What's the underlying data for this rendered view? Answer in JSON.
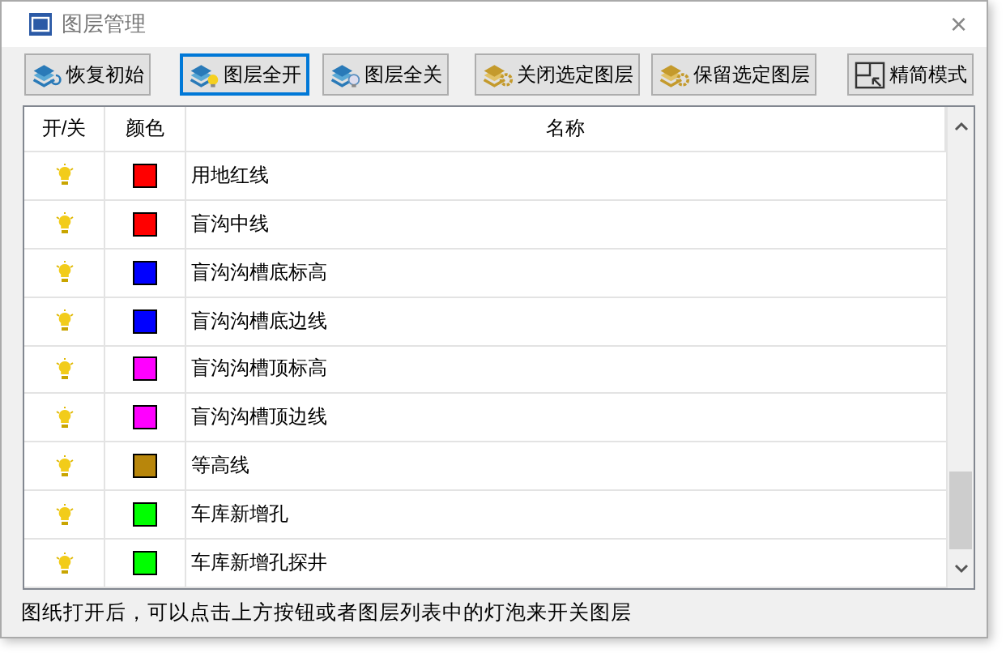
{
  "window": {
    "title": "图层管理",
    "close": "×"
  },
  "toolbar": [
    {
      "label": "恢复初始",
      "kind": "restore",
      "selected": false
    },
    {
      "label": "图层全开",
      "kind": "open",
      "selected": true
    },
    {
      "label": "图层全关",
      "kind": "shut",
      "selected": false
    },
    {
      "label": "关闭选定图层",
      "kind": "gold",
      "selected": false
    },
    {
      "label": "保留选定图层",
      "kind": "gold",
      "selected": false
    },
    {
      "label": "精简模式",
      "kind": "mode",
      "selected": false
    }
  ],
  "table": {
    "columns": [
      "开/关",
      "颜色",
      "名称"
    ],
    "rows": [
      {
        "on": true,
        "color": "#ff0000",
        "name": "用地红线"
      },
      {
        "on": true,
        "color": "#ff0000",
        "name": "盲沟中线"
      },
      {
        "on": true,
        "color": "#0000ff",
        "name": "盲沟沟槽底标高"
      },
      {
        "on": true,
        "color": "#0000ff",
        "name": "盲沟沟槽底边线"
      },
      {
        "on": true,
        "color": "#ff00ff",
        "name": "盲沟沟槽顶标高"
      },
      {
        "on": true,
        "color": "#ff00ff",
        "name": "盲沟沟槽顶边线"
      },
      {
        "on": true,
        "color": "#b8860b",
        "name": "等高线"
      },
      {
        "on": true,
        "color": "#00ff00",
        "name": "车库新增孔"
      },
      {
        "on": true,
        "color": "#00ff00",
        "name": "车库新增孔探井"
      }
    ]
  },
  "status_bar": "图纸打开后，可以点击上方按钮或者图层列表中的灯泡来开关图层"
}
